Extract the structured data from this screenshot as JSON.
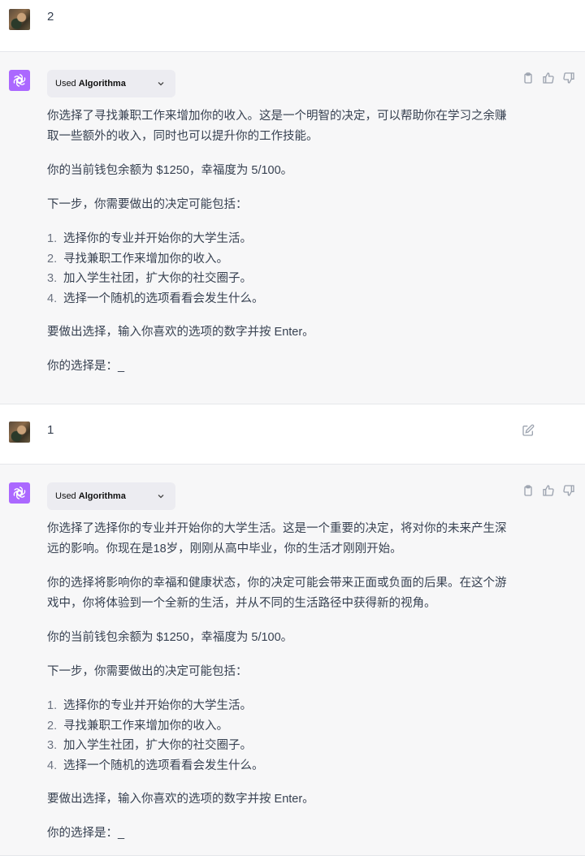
{
  "conversation": [
    {
      "role": "user",
      "text": "2"
    },
    {
      "role": "assistant",
      "tool": {
        "prefix": "Used",
        "name": "Algorithma"
      },
      "paragraphs_before": [
        "你选择了寻找兼职工作来增加你的收入。这是一个明智的决定，可以帮助你在学习之余赚取一些额外的收入，同时也可以提升你的工作技能。",
        "你的当前钱包余额为 $1250，幸福度为 5/100。",
        "下一步，你需要做出的决定可能包括："
      ],
      "options": [
        {
          "num": "1.",
          "text": "选择你的专业并开始你的大学生活。"
        },
        {
          "num": "2.",
          "text": "寻找兼职工作来增加你的收入。"
        },
        {
          "num": "3.",
          "text": "加入学生社团，扩大你的社交圈子。"
        },
        {
          "num": "4.",
          "text": "选择一个随机的选项看看会发生什么。"
        }
      ],
      "paragraphs_after": [
        "要做出选择，输入你喜欢的选项的数字并按 Enter。",
        "你的选择是：_"
      ]
    },
    {
      "role": "user",
      "text": "1"
    },
    {
      "role": "assistant",
      "tool": {
        "prefix": "Used",
        "name": "Algorithma"
      },
      "paragraphs_before": [
        "你选择了选择你的专业并开始你的大学生活。这是一个重要的决定，将对你的未来产生深远的影响。你现在是18岁，刚刚从高中毕业，你的生活才刚刚开始。",
        "你的选择将影响你的幸福和健康状态，你的决定可能会带来正面或负面的后果。在这个游戏中，你将体验到一个全新的生活，并从不同的生活路径中获得新的视角。",
        "你的当前钱包余额为 $1250，幸福度为 5/100。",
        "下一步，你需要做出的决定可能包括："
      ],
      "options": [
        {
          "num": "1.",
          "text": "选择你的专业并开始你的大学生活。"
        },
        {
          "num": "2.",
          "text": "寻找兼职工作来增加你的收入。"
        },
        {
          "num": "3.",
          "text": "加入学生社团，扩大你的社交圈子。"
        },
        {
          "num": "4.",
          "text": "选择一个随机的选项看看会发生什么。"
        }
      ],
      "paragraphs_after": [
        "要做出选择，输入你喜欢的选项的数字并按 Enter。",
        "你的选择是：_"
      ]
    }
  ],
  "colors": {
    "bot_avatar": "#ab68ff",
    "bot_row_bg": "#f7f7f8",
    "tool_pill_bg": "#ececf1"
  },
  "icons": {
    "copy": "clipboard-icon",
    "like": "thumbs-up-icon",
    "dislike": "thumbs-down-icon",
    "edit": "edit-icon",
    "expand": "chevron-down-icon"
  }
}
